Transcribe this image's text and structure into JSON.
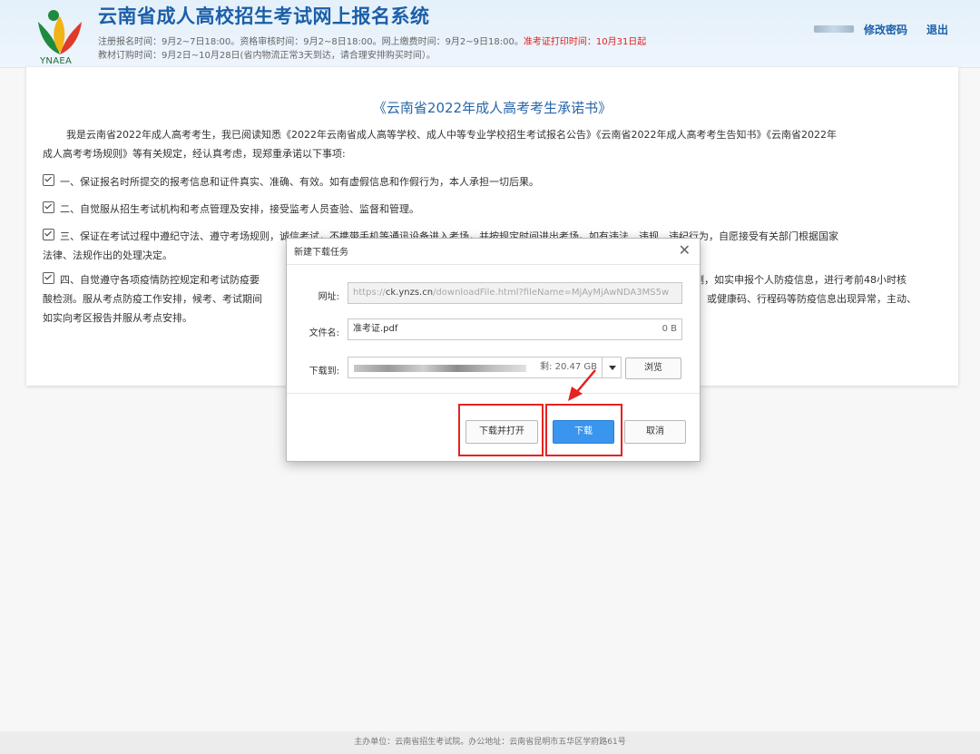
{
  "header": {
    "logo_text": "YNAEA",
    "site_title": "云南省成人高校招生考试网上报名系统",
    "notice_line1": "注册报名时间：9月2~7日18:00。资格审核时间：9月2~8日18:00。网上缴费时间：9月2~9日18:00。",
    "notice_line1_red": "准考证打印时间：10月31日起",
    "notice_line2": "教材订购时间：9月2日~10月28日(省内物流正常3天到达，请合理安排购买时间）。",
    "change_password": "修改密码",
    "logout": "退出"
  },
  "pledge": {
    "title": "《云南省2022年成人高考考生承诺书》",
    "intro_line1": "我是云南省2022年成人高考考生，我已阅读知悉《2022年云南省成人高等学校、成人中等专业学校招生考试报名公告》《云南省2022年成人高考考生告知书》《云南省2022年",
    "intro_line2": "成人高考考场规则》等有关规定，经认真考虑，现郑重承诺以下事项:",
    "item1": "一、保证报名时所提交的报考信息和证件真实、准确、有效。如有虚假信息和作假行为，本人承担一切后果。",
    "item2": "二、自觉服从招生考试机构和考点管理及安排，接受监考人员查验、监督和管理。",
    "item3_a": "三、保证在考试过程中遵纪守法、遵守考场规则，诚信考试，不携带手机等通讯设备进入考场，并按规定时间进出考场。如有违法、违规、违纪行为，自愿接受有关部门根据国家",
    "item3_b": "法律、法规作出的处理决定。",
    "item4_a": "四、自觉遵守各项疫情防控规定和考试防疫要",
    "item4_a_right": "测，如实申报个人防疫信息，进行考前48小时核",
    "item4_b": "酸检测。服从考点防疫工作安排，候考、考试期间",
    "item4_b_right": "或健康码、行程码等防疫信息出现异常，主动、",
    "item4_c": "如实向考区报告并服从考点安排。"
  },
  "dialog": {
    "title": "新建下载任务",
    "close": "✕",
    "url_label": "网址:",
    "url_prefix": "https://",
    "url_host": "ck.ynzs.cn",
    "url_rest": "/downloadFile.html?fileName=MjAyMjAwNDA3MS5w",
    "filename_label": "文件名:",
    "filename_value": "准考证.pdf",
    "filename_size": "0 B",
    "saveto_label": "下载到:",
    "free_space": "剩: 20.47 GB",
    "browse": "浏览",
    "download_open": "下载并打开",
    "download": "下载",
    "cancel": "取消"
  },
  "footer": {
    "text": "主办单位：云南省招生考试院。办公地址：云南省昆明市五华区学府路61号"
  },
  "colors": {
    "brand": "#1b5fa8",
    "highlight": "#e52222",
    "primary_button": "#3a95ee"
  }
}
